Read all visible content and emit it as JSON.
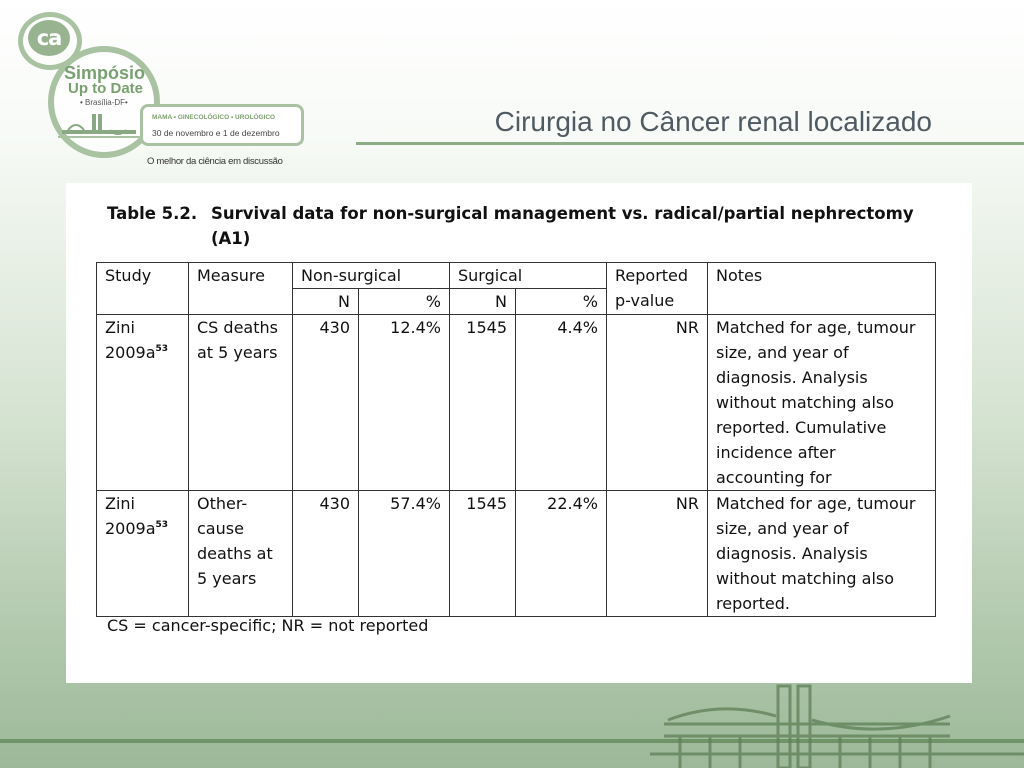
{
  "logo": {
    "ca": "ca",
    "simposio": "Simpósio",
    "uptodate": "Up to Date",
    "brasilia": "• Brasília-DF•",
    "specialties": "MAMA • GINECOLÓGICO • UROLÓGICO",
    "dates": "30 de novembro e 1 de dezembro",
    "tagline": "O melhor da ciência em discussão",
    "accent_color": "#a9c3a2"
  },
  "slide": {
    "title": "Cirurgia no Câncer renal localizado",
    "rule_color": "#8eab88"
  },
  "table": {
    "caption_label": "Table 5.2.",
    "caption_line1": "Survival data for non-surgical management vs. radical/partial nephrectomy",
    "caption_line2": "(A1)",
    "headers": {
      "study": "Study",
      "measure": "Measure",
      "non_surgical": "Non-surgical",
      "surgical": "Surgical",
      "p_value": "Reported p-value",
      "notes": "Notes",
      "n": "N",
      "pct": "%"
    },
    "rows": [
      {
        "study": "Zini 2009a",
        "ref": "53",
        "measure": "CS deaths at 5 years",
        "ns_n": "430",
        "ns_pct": "12.4%",
        "s_n": "1545",
        "s_pct": "4.4%",
        "p_value": "NR",
        "notes": "Matched for age, tumour size, and year of diagnosis.  Analysis without matching also reported.  Cumulative incidence after accounting for"
      },
      {
        "study": "Zini 2009a",
        "ref": "53",
        "measure": "Other-cause deaths at 5 years",
        "ns_n": "430",
        "ns_pct": "57.4%",
        "s_n": "1545",
        "s_pct": "22.4%",
        "p_value": "NR",
        "notes": "Matched for age, tumour size, and year of diagnosis.  Analysis without matching also reported."
      }
    ],
    "footnote": "CS = cancer-specific; NR = not reported"
  }
}
